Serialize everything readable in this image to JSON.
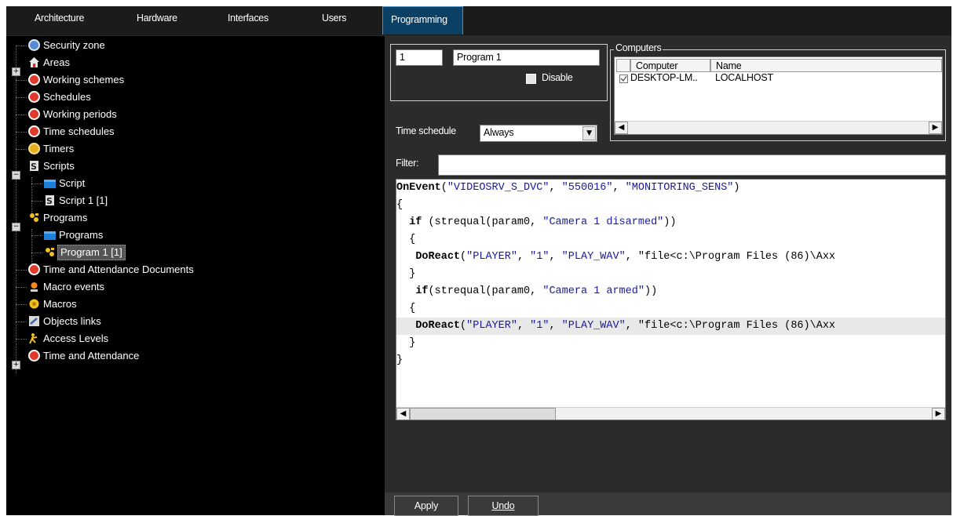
{
  "tabs": [
    {
      "label": "Architecture"
    },
    {
      "label": "Hardware"
    },
    {
      "label": "Interfaces"
    },
    {
      "label": "Users"
    },
    {
      "label": "Programming"
    }
  ],
  "tree": [
    {
      "label": "Security zone",
      "icon": "security-zone-icon"
    },
    {
      "label": "Areas",
      "icon": "areas-icon"
    },
    {
      "label": "Working schemes",
      "icon": "clock-icon"
    },
    {
      "label": "Schedules",
      "icon": "clock-icon"
    },
    {
      "label": "Working periods",
      "icon": "clock-icon"
    },
    {
      "label": "Time schedules",
      "icon": "clock-icon"
    },
    {
      "label": "Timers",
      "icon": "timer-icon"
    },
    {
      "label": "Scripts",
      "icon": "script-icon"
    },
    {
      "label": "Script",
      "icon": "folder-icon"
    },
    {
      "label": "Script 1 [1]",
      "icon": "script-icon"
    },
    {
      "label": "Programs",
      "icon": "program-icon"
    },
    {
      "label": "Programs",
      "icon": "folder-icon"
    },
    {
      "label": "Program 1 [1]",
      "icon": "program-icon"
    },
    {
      "label": "Time and Attendance Documents",
      "icon": "clock-icon"
    },
    {
      "label": "Macro events",
      "icon": "macro-event-icon"
    },
    {
      "label": "Macros",
      "icon": "macro-icon"
    },
    {
      "label": "Objects links",
      "icon": "link-icon"
    },
    {
      "label": "Access Levels",
      "icon": "access-level-icon"
    },
    {
      "label": "Time and Attendance",
      "icon": "clock-icon"
    }
  ],
  "program": {
    "id": "1",
    "name": "Program 1",
    "disable_label": "Disable"
  },
  "computers": {
    "group_label": "Computers",
    "columns": [
      "Computer",
      "Name"
    ],
    "rows": [
      {
        "computer": "DESKTOP-LM..",
        "name": "LOCALHOST"
      }
    ]
  },
  "time_schedule": {
    "label": "Time schedule",
    "value": "Always"
  },
  "filter": {
    "label": "Filter:",
    "value": ""
  },
  "code": [
    [
      {
        "t": "OnEvent",
        "c": "kw"
      },
      {
        "t": "(",
        "c": ""
      },
      {
        "t": "\"VIDEOSRV_S_DVC\"",
        "c": "str"
      },
      {
        "t": ", ",
        "c": ""
      },
      {
        "t": "\"550016\"",
        "c": "str"
      },
      {
        "t": ", ",
        "c": ""
      },
      {
        "t": "\"MONITORING_SENS\"",
        "c": "str"
      },
      {
        "t": ")",
        "c": ""
      }
    ],
    [
      {
        "t": "{",
        "c": ""
      }
    ],
    [
      {
        "t": "  ",
        "c": ""
      },
      {
        "t": "if",
        "c": "kw"
      },
      {
        "t": " (strequal(param0, ",
        "c": ""
      },
      {
        "t": "\"Camera 1 disarmed\"",
        "c": "str"
      },
      {
        "t": "))",
        "c": ""
      }
    ],
    [
      {
        "t": "  {",
        "c": ""
      }
    ],
    [
      {
        "t": "   ",
        "c": ""
      },
      {
        "t": "DoReact",
        "c": "kw"
      },
      {
        "t": "(",
        "c": ""
      },
      {
        "t": "\"PLAYER\"",
        "c": "str"
      },
      {
        "t": ", ",
        "c": ""
      },
      {
        "t": "\"1\"",
        "c": "str"
      },
      {
        "t": ", ",
        "c": ""
      },
      {
        "t": "\"PLAY_WAV\"",
        "c": "str"
      },
      {
        "t": ", ",
        "c": ""
      },
      {
        "t": "\"file<c:\\Program Files (86)\\Axx",
        "c": ""
      }
    ],
    [
      {
        "t": "  }",
        "c": ""
      }
    ],
    [
      {
        "t": "   ",
        "c": ""
      },
      {
        "t": "if",
        "c": "kw"
      },
      {
        "t": "(strequal(param0, ",
        "c": ""
      },
      {
        "t": "\"Camera 1 armed\"",
        "c": "str"
      },
      {
        "t": "))",
        "c": ""
      }
    ],
    [
      {
        "t": "  {",
        "c": ""
      }
    ],
    [
      {
        "t": "   ",
        "c": ""
      },
      {
        "t": "DoReact",
        "c": "kw"
      },
      {
        "t": "(",
        "c": ""
      },
      {
        "t": "\"PLAYER\"",
        "c": "str"
      },
      {
        "t": ", ",
        "c": ""
      },
      {
        "t": "\"1\"",
        "c": "str"
      },
      {
        "t": ", ",
        "c": ""
      },
      {
        "t": "\"PLAY_WAV\"",
        "c": "str"
      },
      {
        "t": ", ",
        "c": ""
      },
      {
        "t": "\"file<c:\\Program Files (86)\\Axx",
        "c": ""
      }
    ],
    [
      {
        "t": "  }",
        "c": ""
      }
    ],
    [
      {
        "t": "}",
        "c": ""
      }
    ]
  ],
  "buttons": {
    "apply": "Apply",
    "undo": "Undo"
  },
  "colors": {
    "active_tab": "#0b3f63",
    "code_string": "#1a1aa0",
    "panel_bg": "#2b2b2b",
    "tree_bg": "#000000"
  }
}
